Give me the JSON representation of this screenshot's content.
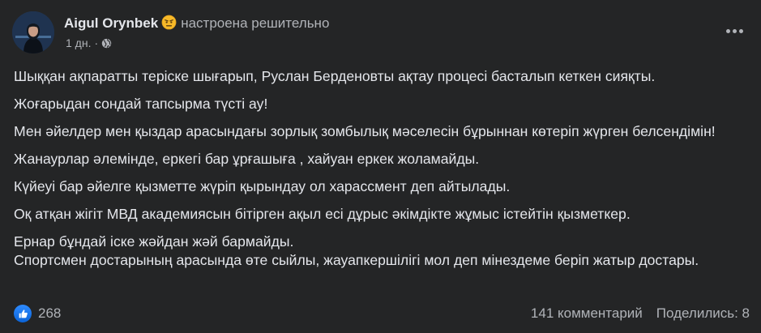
{
  "author": {
    "name": "Aigul Orynbek",
    "feeling": "настроена решительно",
    "feeling_icon": "determined-face-emoji",
    "timestamp": "1 дн.",
    "separator": "·",
    "privacy_icon": "globe-icon",
    "avatar": "avatar-photo"
  },
  "post": {
    "paragraphs": [
      "Шыққан ақпаратты теріске шығарып, Руслан Берденовты  ақтау процесі басталып кеткен сияқты.",
      "Жоғарыдан сондай тапсырма түсті ау!",
      "Мен әйелдер мен қыздар арасындағы зорлық зомбылық мәселесін бұрыннан көтеріп жүрген белсендімін!",
      "Жанаурлар әлемінде,  еркегі бар ұрғашыға , хайуан еркек жоламайды.",
      "Күйеуі бар әйелге  қызметте жүріп  қырындау ол харассмент деп айтылады.",
      "Оқ атқан жігіт МВД академиясын бітірген ақыл есі дұрыс әкімдікте жұмыс істейтін қызметкер.",
      "Ернар бұндай іске жәйдан жәй бармайды.",
      "Спортсмен достарының арасында өте сыйлы,  жауапкершілігі  мол деп мінездеме беріп жатыр достары."
    ]
  },
  "footer": {
    "reaction_icon": "like-icon",
    "reactions_count": "268",
    "comments": "141 комментарий",
    "shares": "Поделились: 8"
  },
  "colors": {
    "background": "#242526",
    "text_primary": "#e4e6eb",
    "text_secondary": "#b0b3b8",
    "like_blue": "#1877f2"
  }
}
